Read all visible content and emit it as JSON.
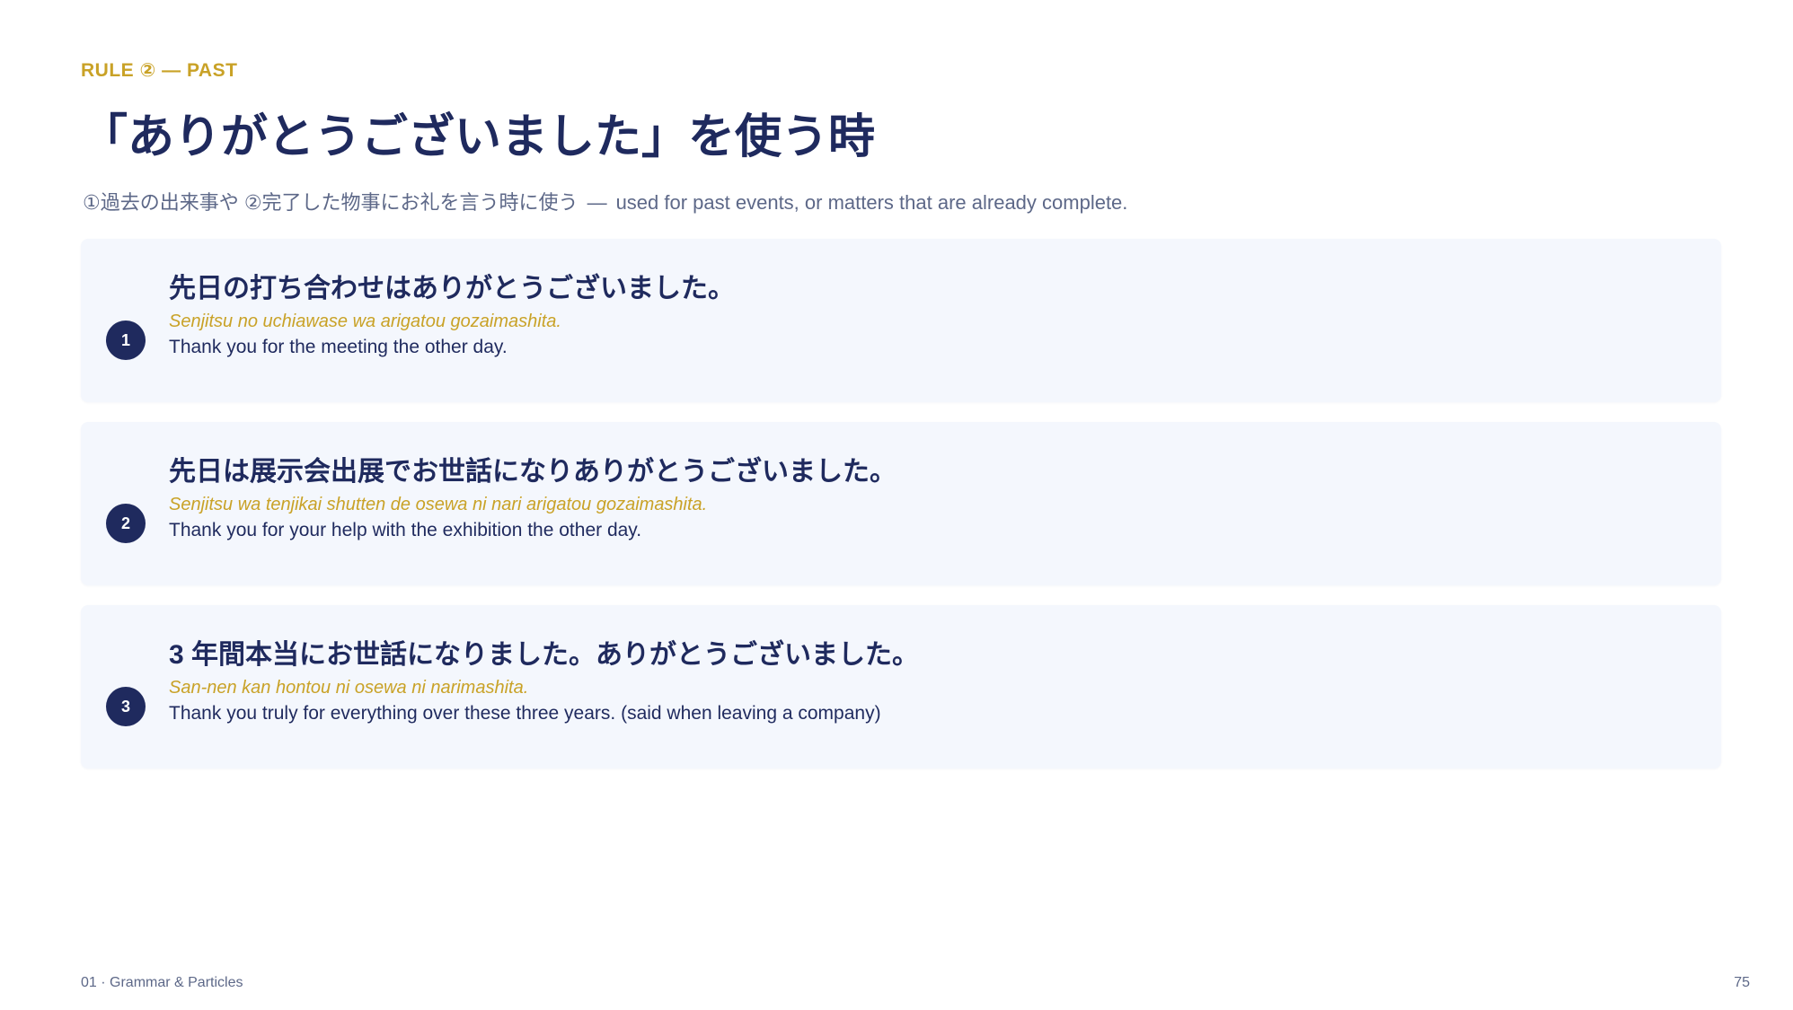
{
  "header": {
    "eyebrow": "RULE ② — PAST",
    "title": "「ありがとうございました」を使う時",
    "subtitle_jp": "①過去の出来事や ②完了した物事にお礼を言う時に使う",
    "subtitle_sep": "—",
    "subtitle_en": "used for past events, or matters that are already complete."
  },
  "examples": [
    {
      "number": "1",
      "japanese": "先日の打ち合わせはありがとうございました。",
      "romaji": "Senjitsu no uchiawase wa arigatou gozaimashita.",
      "english": "Thank you for the meeting the other day."
    },
    {
      "number": "2",
      "japanese": "先日は展示会出展でお世話になりありがとうございました。",
      "romaji": "Senjitsu wa tenjikai shutten de osewa ni nari arigatou gozaimashita.",
      "english": "Thank you for your help with the exhibition the other day."
    },
    {
      "number": "3",
      "japanese": "3 年間本当にお世話になりました。ありがとうございました。",
      "romaji": "San-nen kan hontou ni osewa ni narimashita.",
      "english": "Thank you truly for everything over these three years. (said when leaving a company)"
    }
  ],
  "footer": {
    "section": "01 · Grammar & Particles",
    "page_number": "75"
  },
  "colors": {
    "navy": "#1f2a5e",
    "gold": "#c9a227",
    "muted": "#5d6888",
    "card_bg": "#f4f7fd"
  }
}
